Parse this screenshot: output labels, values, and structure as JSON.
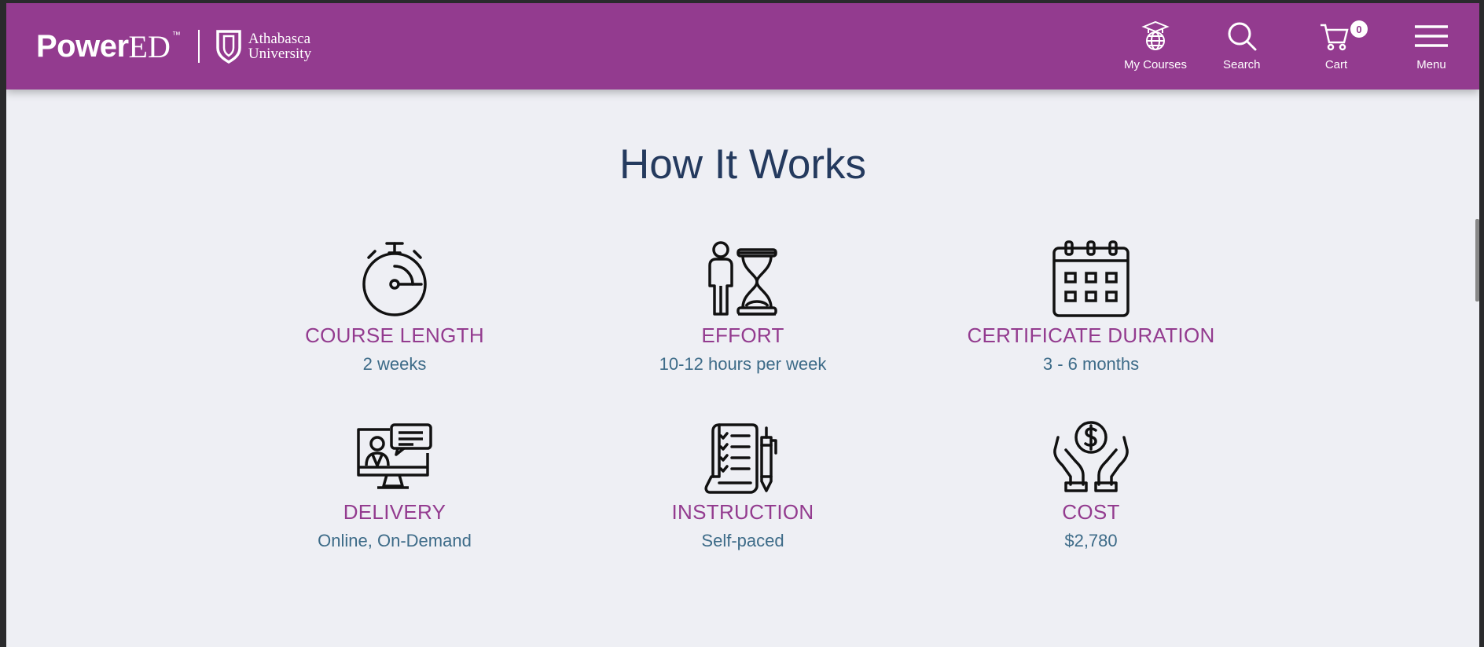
{
  "header": {
    "logo": {
      "brand": "Power",
      "brand_ed": "ED",
      "trademark": "™",
      "university_line1": "Athabasca",
      "university_line2": "University"
    },
    "nav": {
      "my_courses": "My Courses",
      "search": "Search",
      "cart": "Cart",
      "cart_count": "0",
      "menu": "Menu"
    }
  },
  "main": {
    "heading": "How It Works",
    "items": [
      {
        "icon": "stopwatch-icon",
        "title": "COURSE LENGTH",
        "value": "2 weeks"
      },
      {
        "icon": "person-hourglass-icon",
        "title": "EFFORT",
        "value": "10-12 hours per week"
      },
      {
        "icon": "calendar-icon",
        "title": "CERTIFICATE DURATION",
        "value": "3 - 6 months"
      },
      {
        "icon": "online-delivery-icon",
        "title": "DELIVERY",
        "value": "Online, On-Demand"
      },
      {
        "icon": "checklist-scroll-icon",
        "title": "INSTRUCTION",
        "value": "Self-paced"
      },
      {
        "icon": "hands-coin-icon",
        "title": "COST",
        "value": "$2,780"
      }
    ]
  },
  "colors": {
    "header_bg": "#933b8f",
    "page_bg": "#eeeff4",
    "heading": "#243a5e",
    "item_title": "#933b8f",
    "item_value": "#3d6b88"
  }
}
